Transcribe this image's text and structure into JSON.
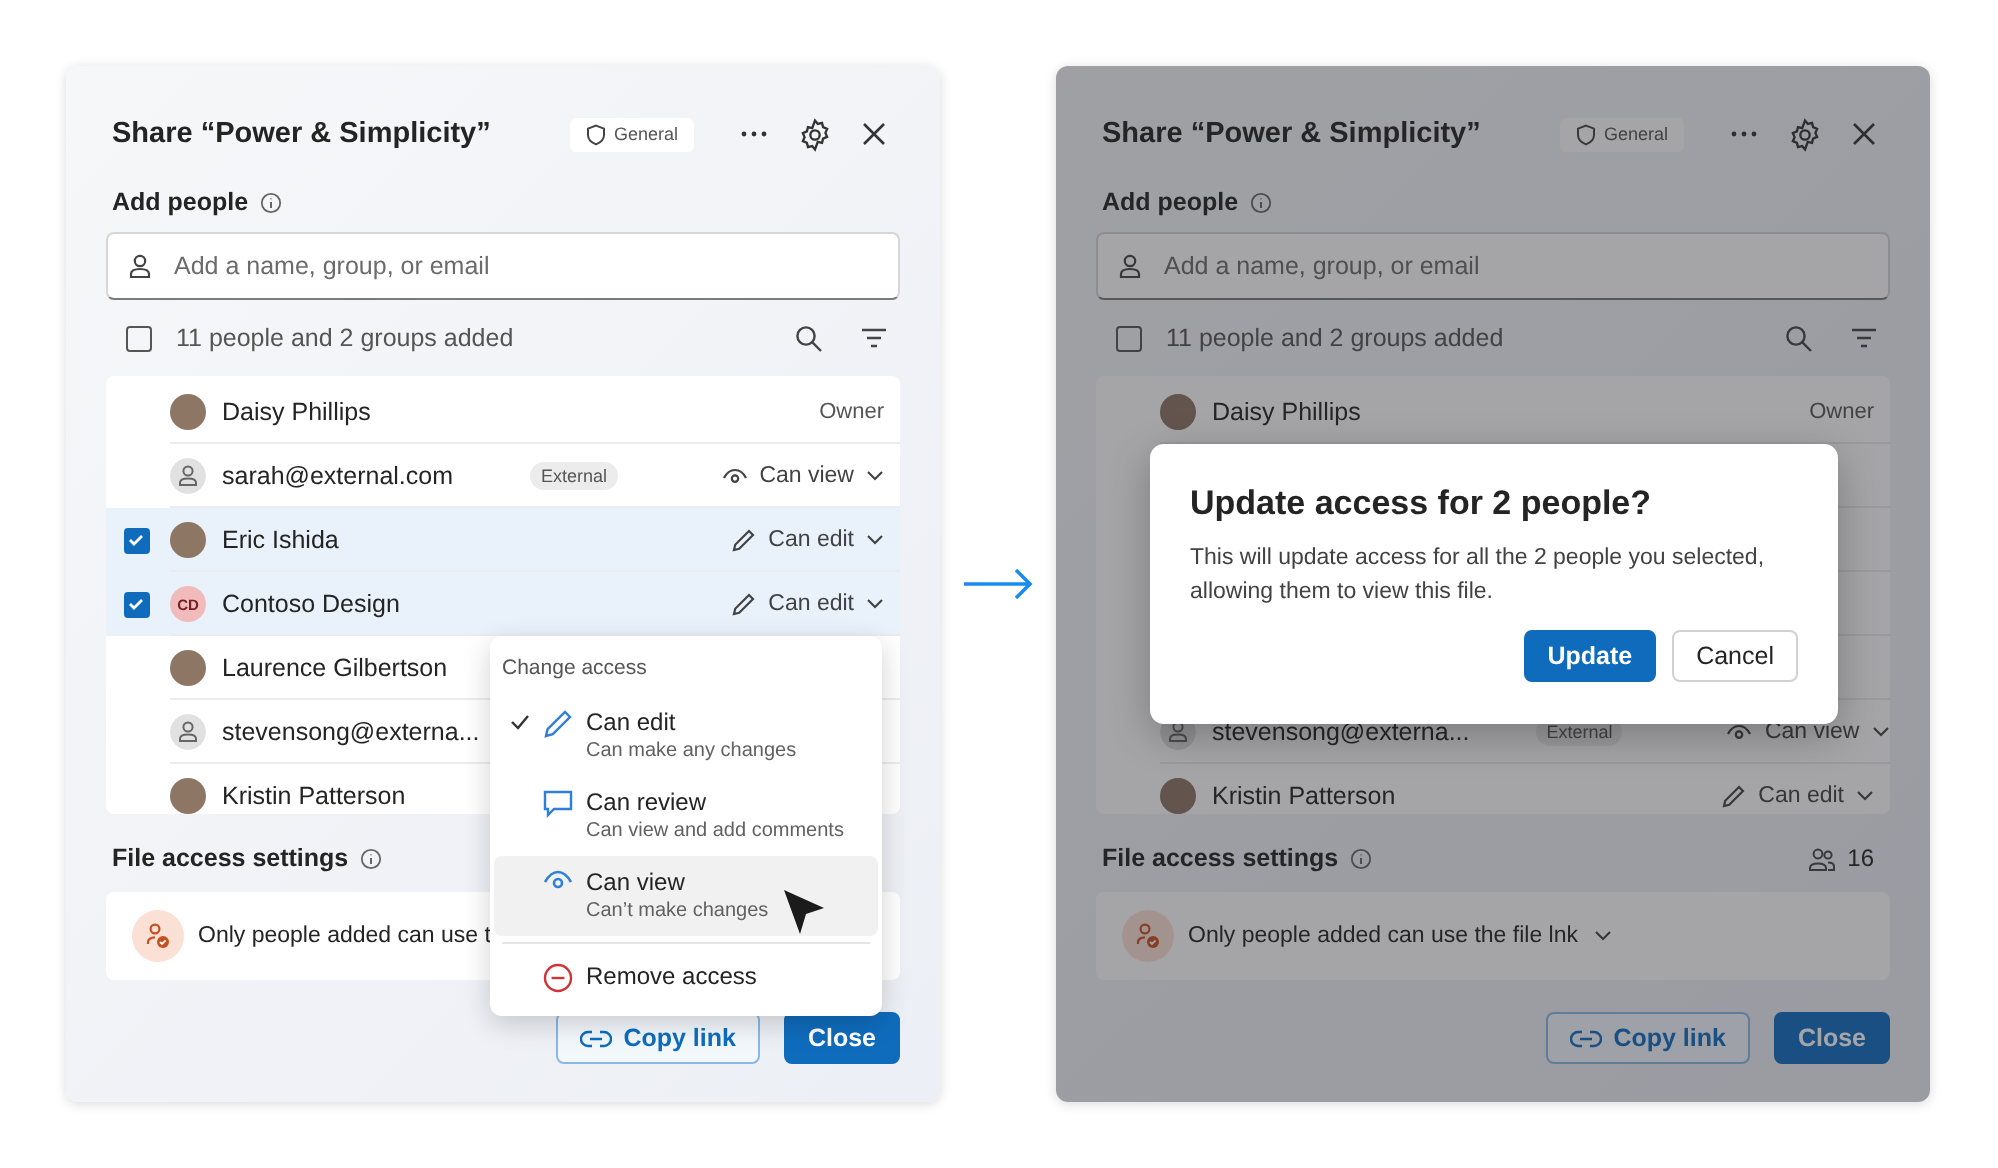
{
  "panels": [
    {
      "dimmed": false,
      "title": "Share “Power & Simplicity”",
      "badge": "General",
      "add_people": "Add people",
      "search_placeholder": "Add a name, group, or email",
      "select_all": {
        "label": "11 people and 2 groups added",
        "checked": false
      },
      "people": [
        {
          "name": "Daisy Phillips",
          "kind": "photo",
          "checked": false,
          "role": {
            "kind": "owner",
            "label": "Owner"
          }
        },
        {
          "name": "sarah@external.com",
          "kind": "generic",
          "tag": "External",
          "checked": false,
          "role": {
            "kind": "view",
            "label": "Can view"
          }
        },
        {
          "name": "Eric Ishida",
          "kind": "photo",
          "checked": true,
          "role": {
            "kind": "edit",
            "label": "Can edit"
          }
        },
        {
          "name": "Contoso Design",
          "kind": "initials",
          "initials": "CD",
          "checked": true,
          "role": {
            "kind": "edit",
            "label": "Can edit"
          }
        },
        {
          "name": "Laurence Gilbertson",
          "kind": "photo",
          "checked": false
        },
        {
          "name": "stevensong@externa...",
          "kind": "generic",
          "checked": false
        },
        {
          "name": "Kristin Patterson",
          "kind": "photo",
          "checked": false
        }
      ],
      "file_access": {
        "label": "File access settings",
        "link_setting": "Only people added can use t",
        "dropdown": false
      },
      "buttons": [
        {
          "kind": "secondary",
          "label": "Copy link"
        },
        {
          "kind": "primary",
          "label": "Close"
        }
      ],
      "menu": {
        "title": "Change access",
        "items": [
          {
            "kind": "edit",
            "label": "Can edit",
            "description": "Can make any changes",
            "checked": true,
            "highlighted": false
          },
          {
            "kind": "review",
            "label": "Can review",
            "description": "Can view and add comments",
            "checked": false,
            "highlighted": false
          },
          {
            "kind": "view",
            "label": "Can view",
            "description": "Can’t make changes",
            "checked": false,
            "highlighted": true
          },
          {
            "kind": "remove",
            "label": "Remove access"
          }
        ]
      }
    },
    {
      "dimmed": true,
      "title": "Share “Power & Simplicity”",
      "badge": "General",
      "add_people": "Add people",
      "search_placeholder": "Add a name, group, or email",
      "select_all": {
        "label": "11 people and 2 groups added",
        "checked": false
      },
      "people": [
        {
          "name": "Daisy Phillips",
          "kind": "photo",
          "checked": false,
          "role": {
            "kind": "owner",
            "label": "Owner"
          }
        },
        {
          "kind": "covered",
          "checked": false,
          "role": {
            "kind": "covered"
          }
        },
        {
          "kind": "covered",
          "checked": false,
          "role": {
            "kind": "covered"
          }
        },
        {
          "kind": "covered",
          "checked": false,
          "role": {
            "kind": "covered"
          }
        },
        {
          "kind": "covered",
          "checked": false,
          "role": {
            "kind": "covered"
          }
        },
        {
          "name": "stevensong@externa...",
          "kind": "generic",
          "tag": "External",
          "checked": false,
          "role": {
            "kind": "view",
            "label": "Can view"
          }
        },
        {
          "name": "Kristin Patterson",
          "kind": "photo",
          "checked": false,
          "role": {
            "kind": "edit",
            "label": "Can edit"
          }
        }
      ],
      "file_access": {
        "label": "File access settings",
        "count": "16",
        "link_setting": "Only people added can use the file lnk",
        "dropdown": true
      },
      "buttons": [
        {
          "kind": "secondary",
          "label": "Copy link"
        },
        {
          "kind": "primary",
          "label": "Close"
        }
      ],
      "dialog": {
        "title": "Update access for 2 people?",
        "body": "This will update access for all the 2 people you selected, allowing them to view this file.",
        "buttons": [
          {
            "kind": "primary",
            "label": "Update"
          },
          {
            "kind": "secondary",
            "label": "Cancel"
          }
        ]
      }
    }
  ]
}
